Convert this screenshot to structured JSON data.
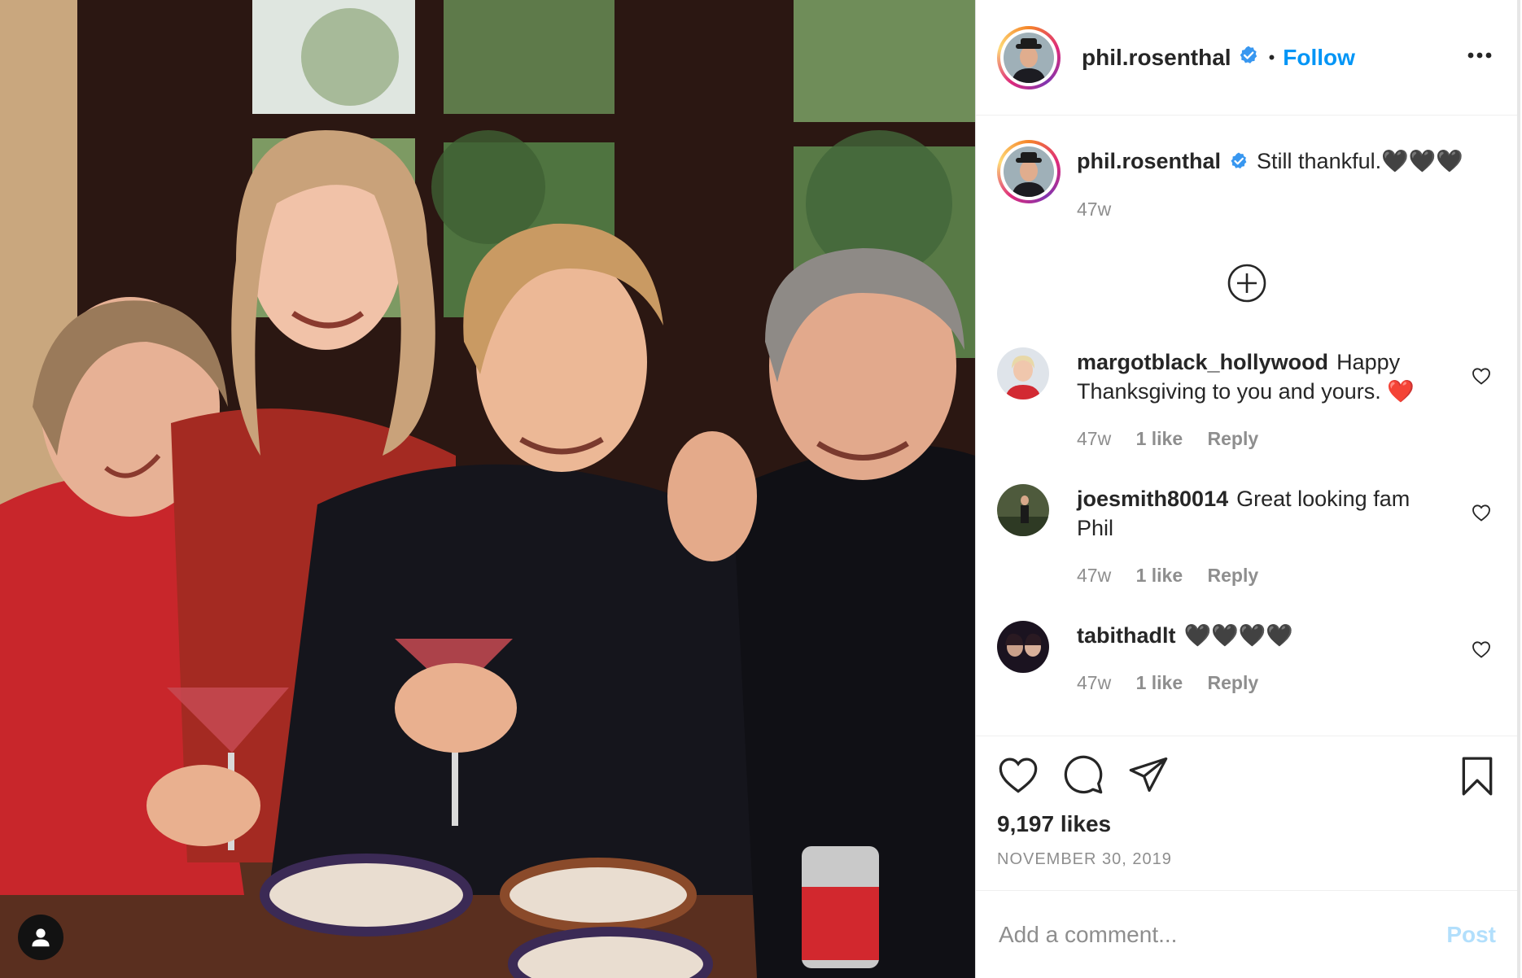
{
  "author": {
    "username": "phil.rosenthal",
    "verified": true,
    "follow_label": "Follow",
    "separator": "•"
  },
  "caption": {
    "username": "phil.rosenthal",
    "text": "Still thankful.🖤🖤🖤",
    "time": "47w"
  },
  "comments": [
    {
      "username": "margotblack_hollywood",
      "text": "Happy Thanksgiving to you and yours. ❤️",
      "time": "47w",
      "likes": "1 like",
      "reply": "Reply"
    },
    {
      "username": "joesmith80014",
      "text": "Great looking fam Phil",
      "time": "47w",
      "likes": "1 like",
      "reply": "Reply"
    },
    {
      "username": "tabithadlt",
      "text": "🖤🖤🖤🖤",
      "time": "47w",
      "likes": "1 like",
      "reply": "Reply"
    }
  ],
  "stats": {
    "likes": "9,197 likes",
    "date": "NOVEMBER 30, 2019"
  },
  "add_comment": {
    "placeholder": "Add a comment...",
    "post_label": "Post"
  },
  "icons": {
    "verified": "verified-badge-icon",
    "more": "more-options-icon",
    "expand": "load-more-comments-icon",
    "like": "heart-icon",
    "comment": "comment-bubble-icon",
    "share": "paper-plane-icon",
    "save": "bookmark-icon",
    "tag": "user-tag-icon"
  },
  "colors": {
    "accent": "#0095f6",
    "post_disabled": "#b2dffc",
    "muted": "#8e8e8e",
    "text": "#262626",
    "verified": "#3897f0"
  }
}
